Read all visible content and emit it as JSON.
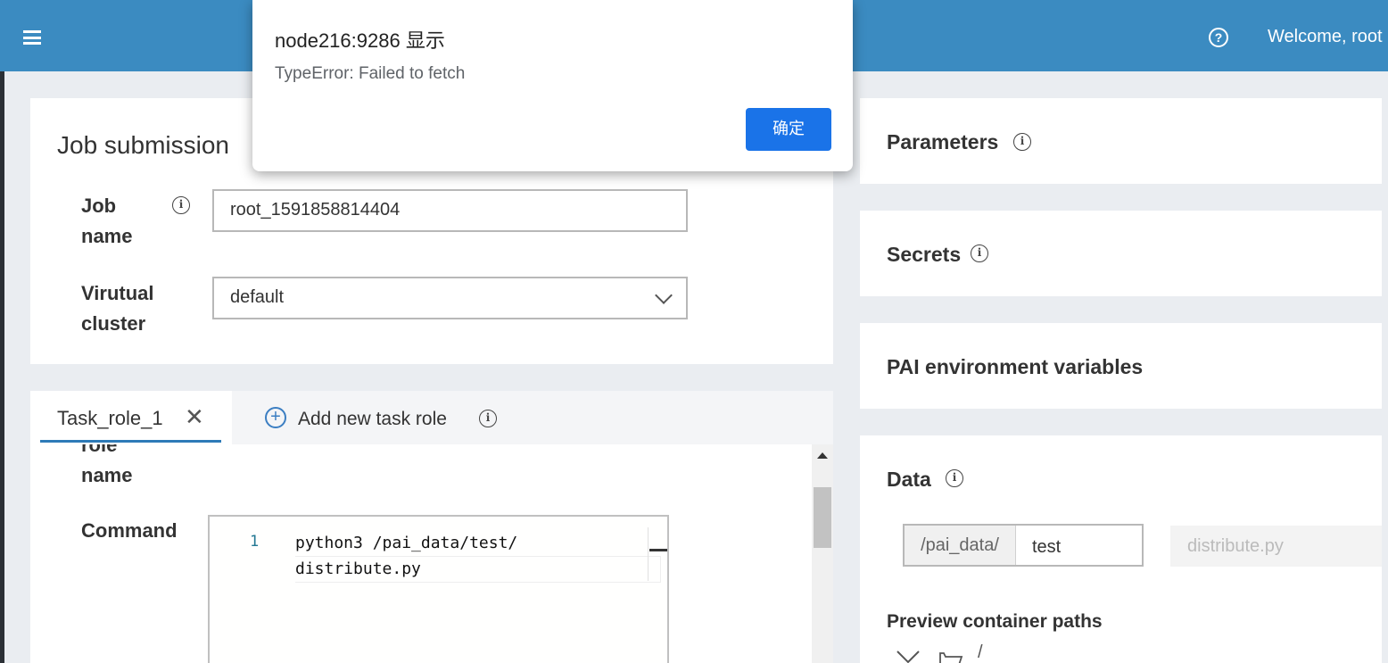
{
  "topbar": {
    "menu_icon": "hamburger-menu-icon",
    "help_icon": "question-circle-icon",
    "help_glyph": "?",
    "welcome_text": "Welcome, root"
  },
  "job_card": {
    "title": "Job submission",
    "job_name_label_1": "Job",
    "job_name_label_2": "name",
    "job_name_value": "root_1591858814404",
    "cluster_label_1": "Virutual",
    "cluster_label_2": "cluster",
    "cluster_value": "default"
  },
  "tabs": {
    "active_tab_label": "Task_role_1",
    "close_glyph": "✕",
    "add_label": "Add new task role",
    "add_glyph": "+"
  },
  "task_role": {
    "role_name_label_1": "role",
    "role_name_label_2": "name",
    "command_label": "Command",
    "line_number": "1",
    "code_line_1": "python3 /pai_data/test/",
    "code_line_2": "distribute.py"
  },
  "side": {
    "parameters_title": "Parameters",
    "secrets_title": "Secrets",
    "env_title": "PAI environment variables",
    "data_title": "Data",
    "data_prefix": "/pai_data/",
    "data_value": "test",
    "data_placeholder": "distribute.py",
    "preview_label": "Preview container paths",
    "tree_root": "/"
  },
  "info_glyph": "i",
  "dialog": {
    "title": "node216:9286 显示",
    "message": "TypeError: Failed to fetch",
    "ok_label": "确定"
  }
}
